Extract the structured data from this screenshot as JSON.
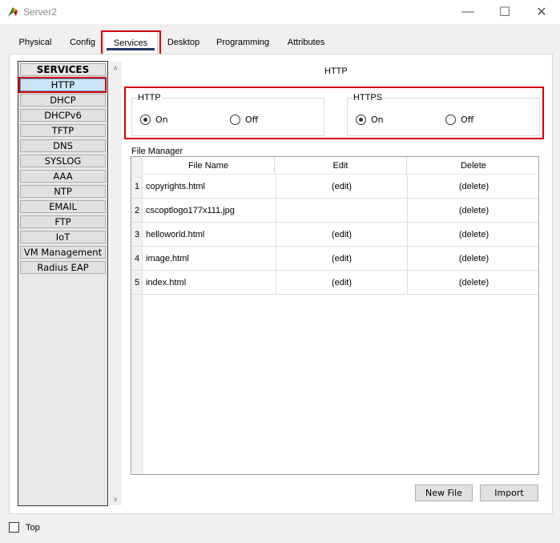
{
  "window": {
    "title": "Server2",
    "minimize_glyph": "—",
    "maximize_glyph": "☐",
    "close_glyph": "✕"
  },
  "tabs": [
    {
      "label": "Physical"
    },
    {
      "label": "Config"
    },
    {
      "label": "Services",
      "active": true
    },
    {
      "label": "Desktop"
    },
    {
      "label": "Programming"
    },
    {
      "label": "Attributes"
    }
  ],
  "services": {
    "header": "SERVICES",
    "items": [
      "HTTP",
      "DHCP",
      "DHCPv6",
      "TFTP",
      "DNS",
      "SYSLOG",
      "AAA",
      "NTP",
      "EMAIL",
      "FTP",
      "IoT",
      "VM Management",
      "Radius EAP"
    ],
    "selected": "HTTP"
  },
  "http_panel": {
    "title": "HTTP",
    "http_group": {
      "label": "HTTP",
      "on_label": "On",
      "off_label": "Off",
      "selected": "On"
    },
    "https_group": {
      "label": "HTTPS",
      "on_label": "On",
      "off_label": "Off",
      "selected": "On"
    }
  },
  "file_manager": {
    "label": "File Manager",
    "columns": [
      "File Name",
      "Edit",
      "Delete"
    ],
    "rows": [
      {
        "num": "1",
        "name": "copyrights.html",
        "edit": "(edit)",
        "delete": "(delete)"
      },
      {
        "num": "2",
        "name": "cscoptlogo177x111.jpg",
        "edit": "",
        "delete": "(delete)"
      },
      {
        "num": "3",
        "name": "helloworld.html",
        "edit": "(edit)",
        "delete": "(delete)"
      },
      {
        "num": "4",
        "name": "image.html",
        "edit": "(edit)",
        "delete": "(delete)"
      },
      {
        "num": "5",
        "name": "index.html",
        "edit": "(edit)",
        "delete": "(delete)"
      }
    ],
    "new_file_label": "New File",
    "import_label": "Import"
  },
  "footer": {
    "top_label": "Top",
    "top_checked": false
  },
  "colors": {
    "highlight": "#d40000",
    "tab_underline": "#1f3864",
    "selected_service": "#cce4f7"
  }
}
